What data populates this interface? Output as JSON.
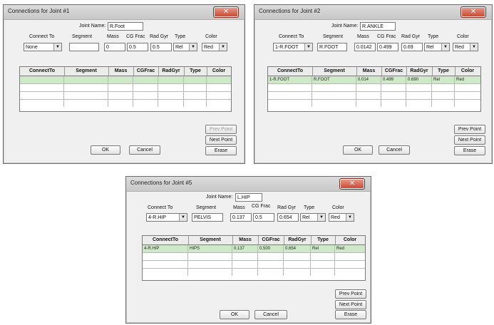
{
  "common": {
    "close_glyph": "✕",
    "joint_name_label": "Joint Name:",
    "col_connect_to": "Connect To",
    "col_segment": "Segment",
    "col_mass": "Mass",
    "col_cg_frac": "CG Frac",
    "col_rad_gyr": "Rad Gyr",
    "col_type": "Type",
    "col_color": "Color",
    "table_headers": [
      "ConnectTo",
      "Segment",
      "Mass",
      "CGFrac",
      "RadGyr",
      "Type",
      "Color"
    ],
    "prev_point": "Prev Point",
    "next_point": "Next Point",
    "erase": "Erase",
    "ok": "OK",
    "cancel": "Cancel",
    "combo_arrow": "▼"
  },
  "dialogs": [
    {
      "title": "Connections for Joint #1",
      "joint_name": "R.Foot",
      "connect_to": "None",
      "segment": "",
      "mass": "0",
      "cg_frac": "0.5",
      "rad_gyr": "0.5",
      "type": "Rel",
      "color": "Red",
      "rows": [
        [
          "",
          "",
          "",
          "",
          "",
          "",
          ""
        ]
      ],
      "prev_point_disabled": true
    },
    {
      "title": "Connections for Joint #2",
      "joint_name": "R.ANKLE",
      "connect_to": "1-R.FOOT",
      "segment": "R.FOOT",
      "mass": "0.0142",
      "cg_frac": "0.499",
      "rad_gyr": "0.69",
      "type": "Rel",
      "color": "Red",
      "rows": [
        [
          "1-R.FOOT",
          "R.FOOT",
          "0.014",
          "0.499",
          "0.690",
          "Rel",
          "Red"
        ]
      ],
      "prev_point_disabled": false
    },
    {
      "title": "Connections for Joint #5",
      "joint_name": "L.HIP",
      "connect_to": "4-R.HIP",
      "segment": "PELVIS",
      "mass": "0.137",
      "cg_frac": "0.5",
      "rad_gyr": "0.654",
      "type": "Rel",
      "color": "Red",
      "rows": [
        [
          "4-R.HIP",
          "HIPS",
          "0.137",
          "0.500",
          "0.654",
          "Rel",
          "Red"
        ]
      ],
      "prev_point_disabled": false
    }
  ]
}
